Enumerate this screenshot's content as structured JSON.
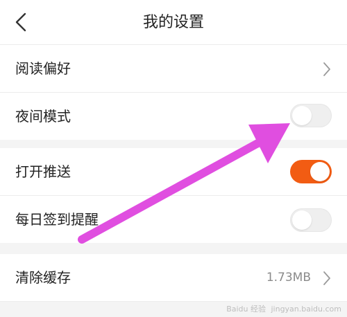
{
  "header": {
    "title": "我的设置",
    "back_icon": "chevron-left-icon"
  },
  "settings": {
    "reading_preference": {
      "label": "阅读偏好",
      "icon": "chevron-right-icon"
    },
    "night_mode": {
      "label": "夜间模式",
      "enabled": false
    },
    "push": {
      "label": "打开推送",
      "enabled": true
    },
    "daily_checkin_reminder": {
      "label": "每日签到提醒",
      "enabled": false
    },
    "clear_cache": {
      "label": "清除缓存",
      "size": "1.73MB",
      "icon": "chevron-right-icon"
    }
  },
  "colors": {
    "accent": "#f25c13",
    "toggle_off": "#efefef",
    "annotation_arrow": "#e04ee0",
    "section_gap": "#f4f4f4"
  },
  "watermark": {
    "text": "Baidu 经验",
    "url_text": "jingyan.baidu.com"
  }
}
